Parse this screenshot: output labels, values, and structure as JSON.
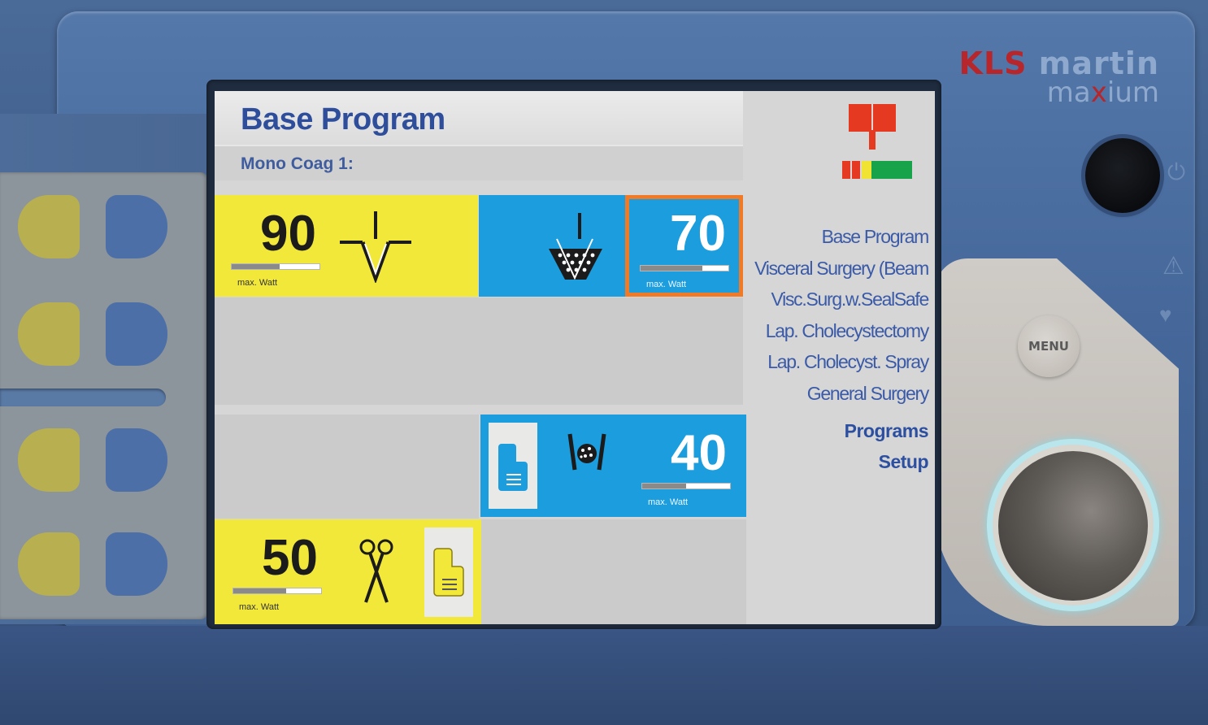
{
  "brand": {
    "maker_prefix": "KLS",
    "maker_rest": " martin",
    "model_prefix": "ma",
    "model_x": "x",
    "model_rest": "ium"
  },
  "hardware": {
    "menu_label": "MENU"
  },
  "screen": {
    "title": "Base Program",
    "subtitle": "Mono Coag 1:",
    "tiles": {
      "cut": {
        "value": "90",
        "max_label": "max. Watt",
        "level": 0.55,
        "color": "#f2e83a",
        "icon": "cut-waveform-icon"
      },
      "coag": {
        "value": "70",
        "max_label": "max. Watt",
        "level": 0.7,
        "color": "#1c9ddd",
        "icon": "soft-coag-icon",
        "selected": true
      },
      "bipolar": {
        "value": "40",
        "max_label": "max. Watt",
        "level": 0.5,
        "color": "#1c9ddd",
        "icon": "bipolar-forceps-icon",
        "pedal_icon": "footswitch-icon"
      },
      "scissors": {
        "value": "50",
        "max_label": "max. Watt",
        "level": 0.6,
        "color": "#f2e83a",
        "icon": "scissors-icon",
        "pedal_icon": "footswitch-icon"
      }
    },
    "status": {
      "icon": "neutral-electrode-icon",
      "indicator_colors": [
        "#e53a21",
        "#f1e332",
        "#17a34a"
      ]
    },
    "programs": [
      "Base Program",
      "Visceral Surgery (Beam",
      "Visc.Surg.w.SealSafe",
      "Lap. Cholecystectomy",
      "Lap. Cholecyst. Spray",
      "General Surgery"
    ],
    "nav": {
      "programs_label": "Programs",
      "setup_label": "Setup"
    }
  },
  "colors": {
    "accent": "#2e4e9c",
    "selected_border": "#f07a25"
  }
}
